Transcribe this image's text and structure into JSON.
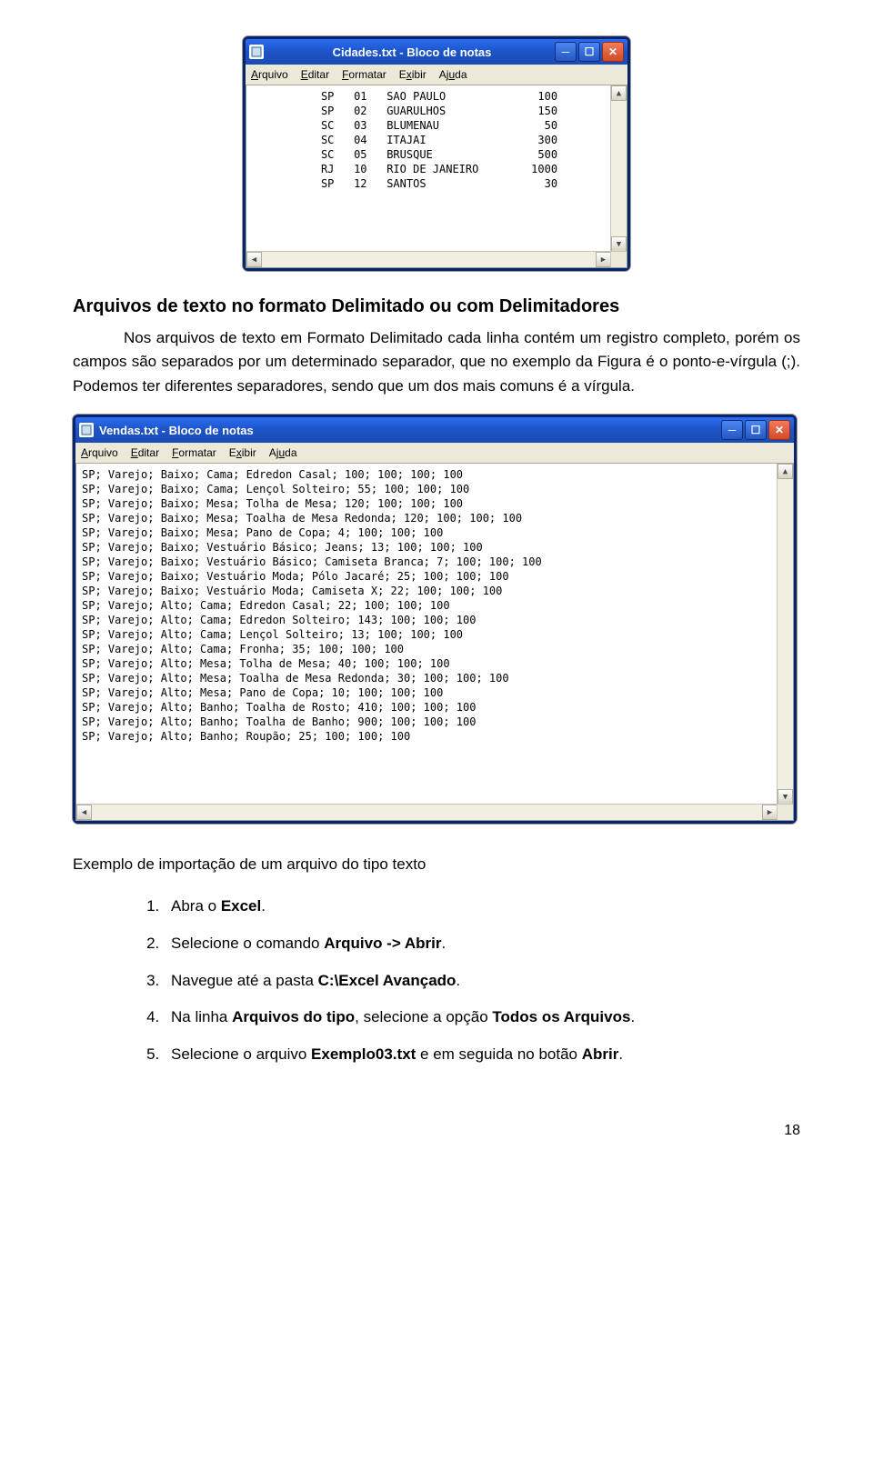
{
  "notepad1": {
    "title": "Cidades.txt - Bloco de notas",
    "menu": [
      "Arquivo",
      "Editar",
      "Formatar",
      "Exibir",
      "Ajuda"
    ],
    "rows": [
      {
        "uf": "SP",
        "cod": "01",
        "cidade": "SAO PAULO",
        "val": "100"
      },
      {
        "uf": "SP",
        "cod": "02",
        "cidade": "GUARULHOS",
        "val": "150"
      },
      {
        "uf": "SC",
        "cod": "03",
        "cidade": "BLUMENAU",
        "val": "50"
      },
      {
        "uf": "SC",
        "cod": "04",
        "cidade": "ITAJAI",
        "val": "300"
      },
      {
        "uf": "SC",
        "cod": "05",
        "cidade": "BRUSQUE",
        "val": "500"
      },
      {
        "uf": "RJ",
        "cod": "10",
        "cidade": "RIO DE JANEIRO",
        "val": "1000"
      },
      {
        "uf": "SP",
        "cod": "12",
        "cidade": "SANTOS",
        "val": "30"
      }
    ]
  },
  "section1_title": "Arquivos de texto no formato Delimitado ou com Delimitadores",
  "section1_body": "Nos arquivos de texto em Formato Delimitado cada linha contém um registro completo, porém os campos são separados por um determinado separador, que no exemplo da Figura é o ponto-e-vírgula (;). Podemos ter diferentes separadores, sendo que um dos mais comuns é a vírgula.",
  "notepad2": {
    "title": "Vendas.txt - Bloco de notas",
    "menu": [
      "Arquivo",
      "Editar",
      "Formatar",
      "Exibir",
      "Ajuda"
    ],
    "lines": [
      "SP; Varejo; Baixo; Cama; Edredon Casal; 100; 100; 100; 100",
      "SP; Varejo; Baixo; Cama; Lençol Solteiro; 55; 100; 100; 100",
      "SP; Varejo; Baixo; Mesa; Tolha de Mesa; 120; 100; 100; 100",
      "SP; Varejo; Baixo; Mesa; Toalha de Mesa Redonda; 120; 100; 100; 100",
      "SP; Varejo; Baixo; Mesa; Pano de Copa; 4; 100; 100; 100",
      "SP; Varejo; Baixo; Vestuário Básico; Jeans; 13; 100; 100; 100",
      "SP; Varejo; Baixo; Vestuário Básico; Camiseta Branca; 7; 100; 100; 100",
      "SP; Varejo; Baixo; Vestuário Moda; Pólo Jacaré; 25; 100; 100; 100",
      "SP; Varejo; Baixo; Vestuário Moda; Camiseta X; 22; 100; 100; 100",
      "SP; Varejo; Alto; Cama; Edredon Casal; 22; 100; 100; 100",
      "SP; Varejo; Alto; Cama; Edredon Solteiro; 143; 100; 100; 100",
      "SP; Varejo; Alto; Cama; Lençol Solteiro; 13; 100; 100; 100",
      "SP; Varejo; Alto; Cama; Fronha; 35; 100; 100; 100",
      "SP; Varejo; Alto; Mesa; Tolha de Mesa; 40; 100; 100; 100",
      "SP; Varejo; Alto; Mesa; Toalha de Mesa Redonda; 30; 100; 100; 100",
      "SP; Varejo; Alto; Mesa; Pano de Copa; 10; 100; 100; 100",
      "SP; Varejo; Alto; Banho; Toalha de Rosto; 410; 100; 100; 100",
      "SP; Varejo; Alto; Banho; Toalha de Banho; 900; 100; 100; 100",
      "SP; Varejo; Alto; Banho; Roupão; 25; 100; 100; 100"
    ]
  },
  "example_title": "Exemplo de importação de um arquivo do tipo texto",
  "steps": [
    {
      "pre": "Abra o ",
      "b": "Excel",
      "post": "."
    },
    {
      "pre": "Selecione o comando ",
      "b": "Arquivo -> Abrir",
      "post": "."
    },
    {
      "pre": "Navegue até a pasta ",
      "b": "C:\\Excel Avançado",
      "post": "."
    },
    {
      "pre": "Na linha ",
      "b": "Arquivos do tipo",
      "post": ", selecione a opção ",
      "b2": "Todos os Arquivos",
      "post2": "."
    },
    {
      "pre": "Selecione o arquivo ",
      "b": "Exemplo03.txt",
      "post": " e em seguida no botão ",
      "b2": "Abrir",
      "post2": "."
    }
  ],
  "pagenum": "18"
}
